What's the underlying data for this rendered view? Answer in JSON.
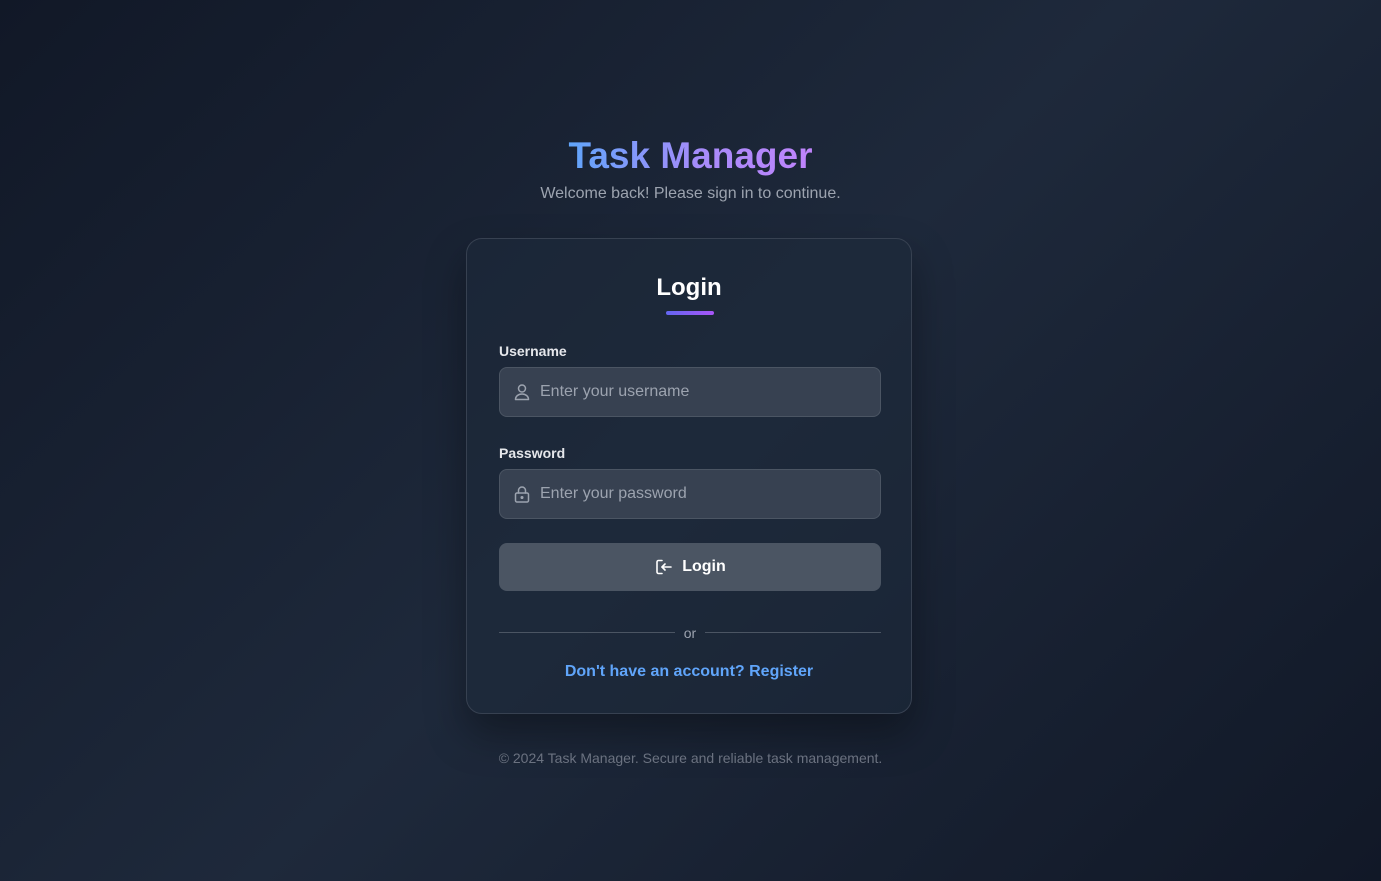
{
  "header": {
    "title": "Task Manager",
    "subtitle": "Welcome back! Please sign in to continue."
  },
  "login_card": {
    "title": "Login",
    "username": {
      "label": "Username",
      "value": "",
      "placeholder": "Enter your username",
      "icon": "user-icon"
    },
    "password": {
      "label": "Password",
      "value": "",
      "placeholder": "Enter your password",
      "icon": "lock-icon"
    },
    "submit_button": {
      "label": "Login",
      "icon": "login-icon"
    },
    "divider_text": "or",
    "register_link": "Don't have an account? Register"
  },
  "footer": {
    "text": "© 2024 Task Manager. Secure and reliable task management."
  },
  "colors": {
    "background": "#111827",
    "card": "#1e293b",
    "accent_gradient_start": "#60a5fa",
    "accent_gradient_end": "#c084fc",
    "link": "#60a5fa",
    "button": "#4b5563"
  }
}
